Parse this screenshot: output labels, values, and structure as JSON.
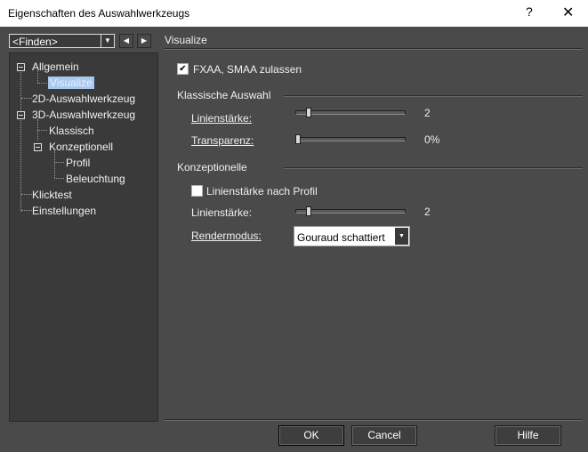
{
  "window": {
    "title": "Eigenschaften des Auswahlwerkzeugs",
    "help_glyph": "?",
    "close_glyph": "✕"
  },
  "find": {
    "value": "<Finden>",
    "arrow_icon": "chevron-down-icon",
    "prev_icon": "triangle-left-icon",
    "next_icon": "triangle-right-icon"
  },
  "tree": {
    "items": [
      {
        "label": "Allgemein",
        "expanded": true
      },
      {
        "label": "Visualize",
        "selected": true
      },
      {
        "label": "2D-Auswahlwerkzeug"
      },
      {
        "label": "3D-Auswahlwerkzeug",
        "expanded": true
      },
      {
        "label": "Klassisch"
      },
      {
        "label": "Konzeptionell",
        "expanded": true
      },
      {
        "label": "Profil"
      },
      {
        "label": "Beleuchtung"
      },
      {
        "label": "Klicktest"
      },
      {
        "label": "Einstellungen"
      }
    ]
  },
  "panel": {
    "title": "Visualize",
    "fxaa": {
      "label": "FXAA, SMAA zulassen",
      "checked": true
    },
    "classic": {
      "heading": "Klassische Auswahl",
      "line_width_label": "Linienstärke:",
      "line_width_value": "2",
      "line_width_fraction": 0.12,
      "transparency_label": "Transparenz:",
      "transparency_value": "0%",
      "transparency_fraction": 0.0
    },
    "conceptual": {
      "heading": "Konzeptionelle",
      "profile_checkbox_label": "Linienstärke nach Profil",
      "profile_checked": false,
      "line_width_label": "Linienstärke:",
      "line_width_value": "2",
      "line_width_fraction": 0.12,
      "render_mode_label": "Rendermodus:",
      "render_mode_value": "Gouraud schattiert"
    }
  },
  "buttons": {
    "ok": "OK",
    "cancel": "Cancel",
    "help": "Hilfe"
  },
  "colors": {
    "background": "#4a4a4a",
    "tree_background": "#3a3a3a",
    "selection": "#a8c8f0"
  }
}
